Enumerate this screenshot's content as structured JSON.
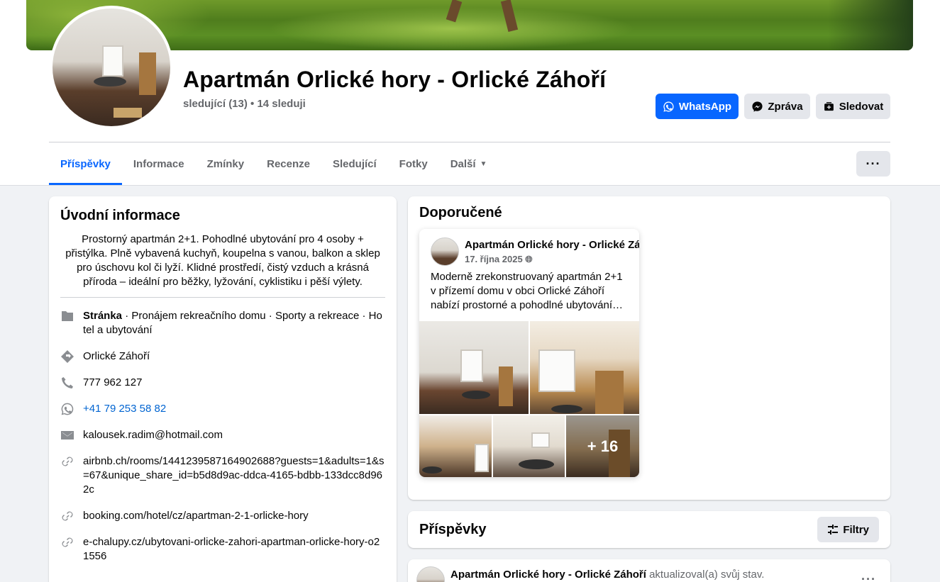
{
  "page": {
    "title": "Apartmán Orlické hory - Orlické Záhoří",
    "followers": "sledující (13) • 14 sleduji"
  },
  "actions": {
    "whatsapp": "WhatsApp",
    "message": "Zpráva",
    "follow": "Sledovat"
  },
  "tabs": [
    {
      "label": "Příspěvky"
    },
    {
      "label": "Informace"
    },
    {
      "label": "Zmínky"
    },
    {
      "label": "Recenze"
    },
    {
      "label": "Sledující"
    },
    {
      "label": "Fotky"
    },
    {
      "label": "Další"
    }
  ],
  "more_label": "···",
  "intro": {
    "title": "Úvodní informace",
    "bio": "Prostorný apartmán 2+1. Pohodlné ubytování pro 4 osoby + přistýlka. Plně vybavená kuchyň, koupelna s vanou, balkon a sklep pro úschovu kol či lyží. Klidné prostředí, čistý vzduch a krásná příroda – ideální pro běžky, lyžování, cyklistiku i pěší výlety.",
    "category_label": "Stránka",
    "category_text": " · Pronájem rekreačního domu · Sporty a rekreace · Hotel a ubytování",
    "location": "Orlické Záhoří",
    "phone": "777 962 127",
    "whatsapp_number": "+41 79 253 58 82",
    "email": "kalousek.radim@hotmail.com",
    "links": [
      "airbnb.ch/rooms/1441239587164902688?guests=1&adults=1&s=67&unique_share_id=b5d8d9ac-ddca-4165-bdbb-133dcc8d962c",
      "booking.com/hotel/cz/apartman-2-1-orlicke-hory",
      "e-chalupy.cz/ubytovani-orlicke-zahori-apartman-orlicke-hory-o21556"
    ]
  },
  "recommended": {
    "title": "Doporučené",
    "post": {
      "author": "Apartmán Orlické hory - Orlické Záh",
      "date": "17. října 2025",
      "text": "Moderně zrekonstruovaný apartmán 2+1 v přízemí domu v obci Orlické Záhoří nabízí prostorné a pohodlné ubytování…",
      "more_photos": "+ 16"
    }
  },
  "posts": {
    "title": "Příspěvky",
    "filter_label": "Filtry",
    "first_author": "Apartmán Orlické hory - Orlické Záhoří",
    "first_action": " aktualizoval(a) svůj stav.",
    "dots": "···"
  },
  "colors": {
    "accent": "#0866ff",
    "link": "#0064d1",
    "secondary_text": "#65676b",
    "button_gray": "#e4e6eb"
  },
  "icons": [
    "whatsapp-icon",
    "messenger-icon",
    "follow-icon",
    "page-icon",
    "location-icon",
    "phone-icon",
    "whatsapp-icon",
    "email-icon",
    "link-icon",
    "globe-icon",
    "filter-icon"
  ]
}
